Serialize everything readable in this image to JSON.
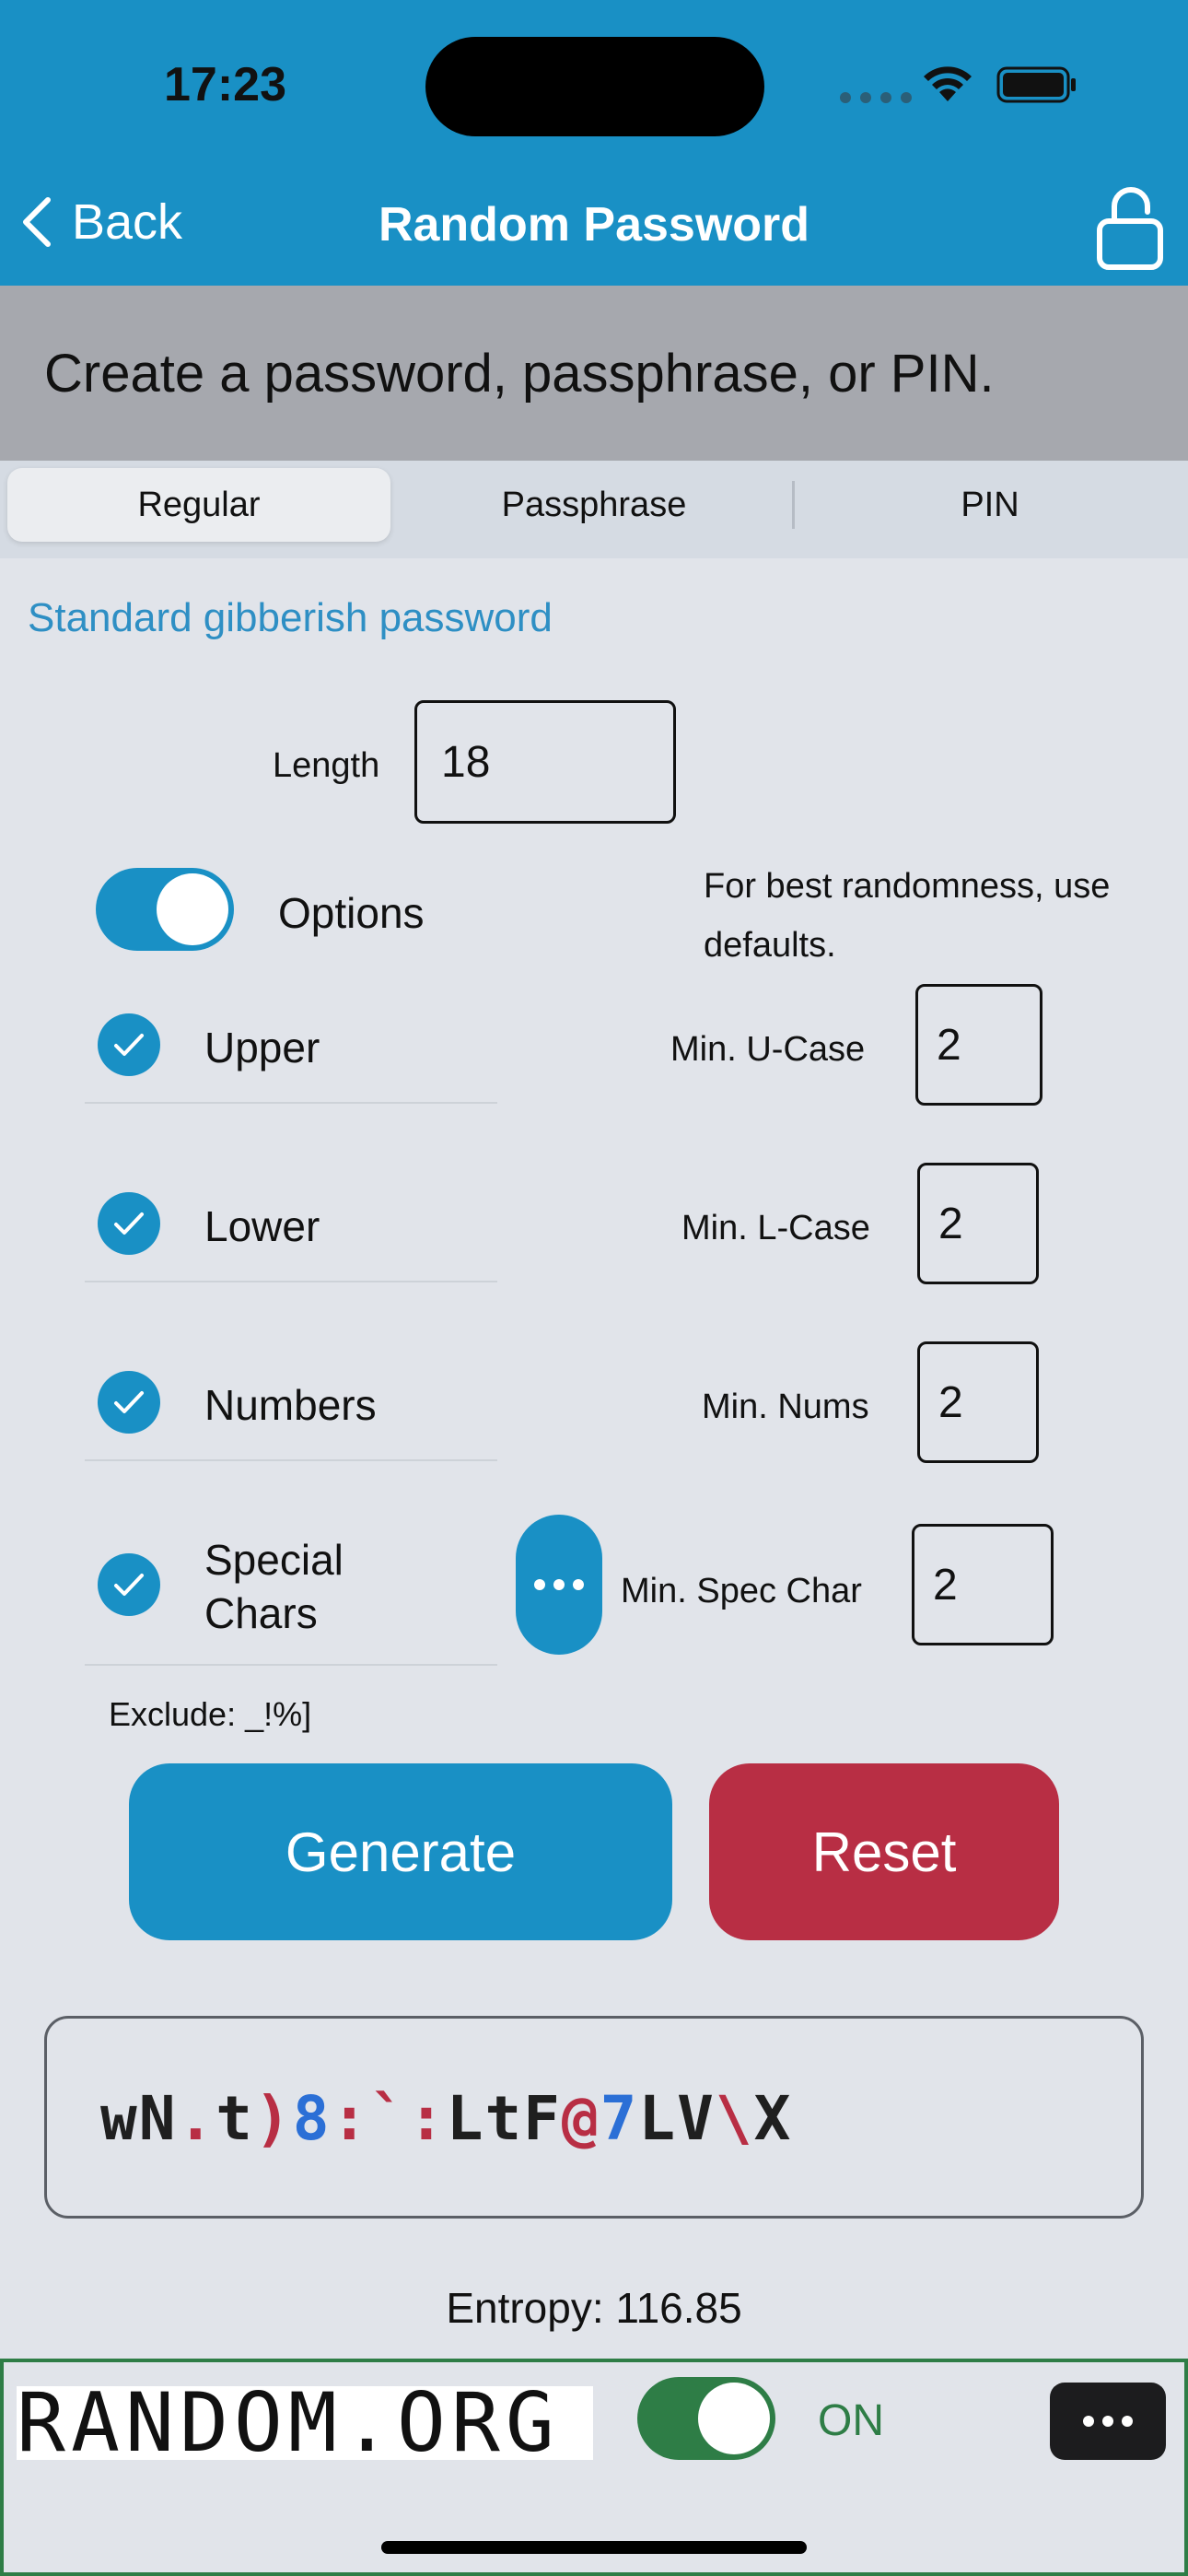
{
  "status_bar": {
    "time": "17:23"
  },
  "nav": {
    "back_label": "Back",
    "title": "Random Password"
  },
  "banner": {
    "text": "Create a password, passphrase, or PIN."
  },
  "tabs": [
    {
      "label": "Regular",
      "selected": true
    },
    {
      "label": "Passphrase",
      "selected": false
    },
    {
      "label": "PIN",
      "selected": false
    }
  ],
  "mode_description": "Standard gibberish password",
  "length": {
    "label": "Length",
    "value": "18"
  },
  "options": {
    "label": "Options",
    "enabled": true,
    "hint": "For best randomness, use defaults."
  },
  "char_sets": [
    {
      "label": "Upper",
      "checked": true,
      "min_label": "Min. U-Case",
      "min_value": "2"
    },
    {
      "label": "Lower",
      "checked": true,
      "min_label": "Min. L-Case",
      "min_value": "2"
    },
    {
      "label": "Numbers",
      "checked": true,
      "min_label": "Min. Nums",
      "min_value": "2"
    },
    {
      "label": "Special Chars",
      "checked": true,
      "min_label": "Min. Spec Char",
      "min_value": "2"
    }
  ],
  "exclude": "Exclude: _!%]",
  "buttons": {
    "generate": "Generate",
    "reset": "Reset"
  },
  "password": {
    "segments": [
      {
        "text": "wN",
        "color": "#1f1f1f"
      },
      {
        "text": ".",
        "color": "#b82e44"
      },
      {
        "text": "t",
        "color": "#1f1f1f"
      },
      {
        "text": ")",
        "color": "#b82e44"
      },
      {
        "text": "8",
        "color": "#2b6fd6"
      },
      {
        "text": ":`:",
        "color": "#b82e44"
      },
      {
        "text": "LtF",
        "color": "#1f1f1f"
      },
      {
        "text": "@",
        "color": "#b82e44"
      },
      {
        "text": "7",
        "color": "#2b6fd6"
      },
      {
        "text": "LV",
        "color": "#1f1f1f"
      },
      {
        "text": "\\",
        "color": "#b82e44"
      },
      {
        "text": "X",
        "color": "#1f1f1f"
      }
    ]
  },
  "entropy": "Entropy: 116.85",
  "footer": {
    "logo_text": "RANDOM.ORG",
    "toggle_on": true,
    "toggle_label": "ON"
  },
  "colors": {
    "accent": "#1990c5",
    "danger": "#b82e44",
    "success": "#2e7d46",
    "digit": "#2b6fd6"
  },
  "icons": [
    "wifi-icon",
    "battery-icon",
    "chevron-left-icon",
    "lock-icon",
    "checkmark-icon",
    "more-dots-icon"
  ]
}
